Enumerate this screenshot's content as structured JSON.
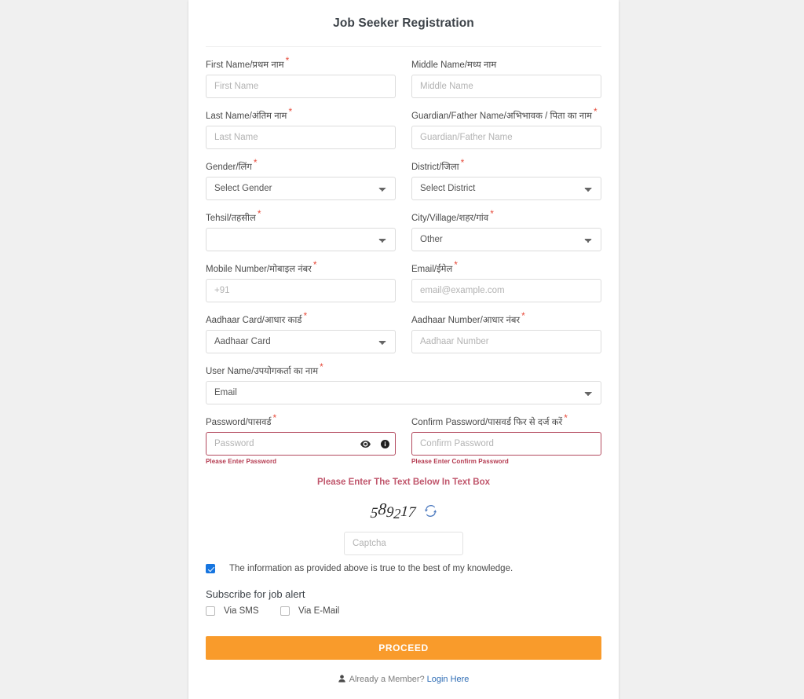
{
  "page": {
    "background_color": "#f0f0f0",
    "card_background": "#ffffff",
    "accent_color": "#f99b2b",
    "error_color": "#b4394f",
    "link_color": "#2f6db5",
    "required_marker": "*"
  },
  "header": {
    "title": "Job Seeker Registration"
  },
  "fields": {
    "first_name": {
      "label": "First Name/प्रथम नाम",
      "placeholder": "First Name",
      "value": "",
      "required": true
    },
    "middle_name": {
      "label": "Middle Name/मध्य नाम",
      "placeholder": "Middle Name",
      "value": "",
      "required": false
    },
    "last_name": {
      "label": "Last Name/अंतिम नाम",
      "placeholder": "Last Name",
      "value": "",
      "required": true
    },
    "guardian_name": {
      "label": "Guardian/Father Name/अभिभावक / पिता का नाम",
      "placeholder": "Guardian/Father Name",
      "value": "",
      "required": true
    },
    "gender": {
      "label": "Gender/लिंग",
      "selected": "Select Gender",
      "required": true
    },
    "district": {
      "label": "District/जिला",
      "selected": "Select District",
      "required": true
    },
    "tehsil": {
      "label": "Tehsil/तहसील",
      "selected": "",
      "required": true
    },
    "city_village": {
      "label": "City/Village/शहर/गांव",
      "selected": "Other",
      "required": true
    },
    "mobile": {
      "label": "Mobile Number/मोबाइल नंबर",
      "placeholder": "+91",
      "value": "",
      "required": true
    },
    "email": {
      "label": "Email/ईमेल",
      "placeholder": "email@example.com",
      "value": "",
      "required": true
    },
    "aadhaar_card": {
      "label": "Aadhaar Card/आधार कार्ड",
      "selected": "Aadhaar Card",
      "required": true
    },
    "aadhaar_number": {
      "label": "Aadhaar Number/आधार नंबर",
      "placeholder": "Aadhaar Number",
      "value": "",
      "required": true
    },
    "user_name": {
      "label": "User Name/उपयोगकर्ता का नाम",
      "selected": "Email",
      "required": true
    },
    "password": {
      "label": "Password/पासवर्ड",
      "placeholder": "Password",
      "value": "",
      "required": true,
      "error": "Please Enter Password",
      "has_error": true
    },
    "confirm_password": {
      "label": "Confirm Password/पासवर्ड फिर से दर्ज करें",
      "placeholder": "Confirm Password",
      "value": "",
      "required": true,
      "error": "Please Enter Confirm Password",
      "has_error": true
    }
  },
  "captcha": {
    "heading": "Please Enter The Text Below In Text Box",
    "code": "589217",
    "digits": [
      "5",
      "8",
      "9",
      "2",
      "1",
      "7"
    ],
    "refresh_icon": "refresh-icon",
    "placeholder": "Captcha",
    "value": ""
  },
  "consent": {
    "checked": true,
    "text": "The information as provided above is true to the best of my knowledge."
  },
  "subscribe": {
    "title": "Subscribe for job alert",
    "options": [
      {
        "label": "Via SMS",
        "checked": false
      },
      {
        "label": "Via E-Mail",
        "checked": false
      }
    ]
  },
  "actions": {
    "proceed_label": "PROCEED"
  },
  "footer": {
    "member_text": "Already a Member?",
    "login_label": "Login Here"
  }
}
